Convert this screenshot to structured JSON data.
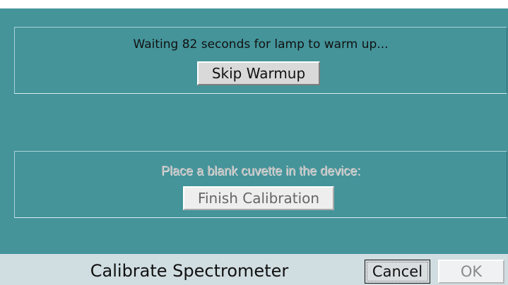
{
  "warmup": {
    "message": "Waiting 82 seconds for lamp to warm up...",
    "skip_label": "Skip Warmup"
  },
  "blank": {
    "message": "Place a blank cuvette in the device:",
    "finish_label": "Finish Calibration"
  },
  "footer": {
    "title": "Calibrate Spectrometer",
    "cancel_label": "Cancel",
    "ok_label": "OK"
  },
  "colors": {
    "main_background": "#44949a",
    "footer_background": "#d0dde1"
  }
}
